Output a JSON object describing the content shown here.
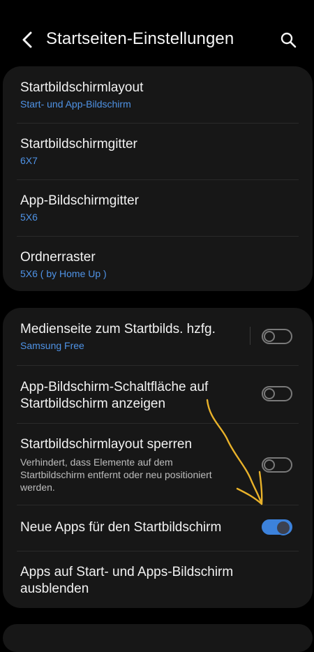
{
  "header": {
    "title": "Startseiten-Einstellungen"
  },
  "group1": {
    "items": [
      {
        "title": "Startbildschirmlayout",
        "value": "Start- und App-Bildschirm"
      },
      {
        "title": "Startbildschirmgitter",
        "value": "6X7"
      },
      {
        "title": "App-Bildschirmgitter",
        "value": "5X6"
      },
      {
        "title": "Ordnerraster",
        "value": "5X6 ( by Home Up )"
      }
    ]
  },
  "group2": {
    "items": [
      {
        "title": "Medienseite zum Startbilds. hzfg.",
        "value": "Samsung Free",
        "toggle": false
      },
      {
        "title_line1": "App-Bildschirm-Schaltfläche auf",
        "title_line2": "Startbildschirm anzeigen",
        "toggle": false
      },
      {
        "title": "Startbildschirmlayout sperren",
        "description": "Verhindert, dass Elemente auf dem Startbildschirm entfernt oder neu positioniert werden.",
        "toggle": false
      },
      {
        "title": "Neue Apps für den Startbildschirm",
        "toggle": true
      },
      {
        "title_line1": "Apps auf Start- und Apps-Bildschirm",
        "title_line2": "ausblenden"
      }
    ]
  },
  "colors": {
    "accent": "#3c82dc",
    "subtext_blue": "#4f93e6",
    "card_bg": "#171717",
    "annotation": "#e9b22a"
  },
  "icons": {
    "back": "chevron-left-icon",
    "search": "search-icon"
  }
}
